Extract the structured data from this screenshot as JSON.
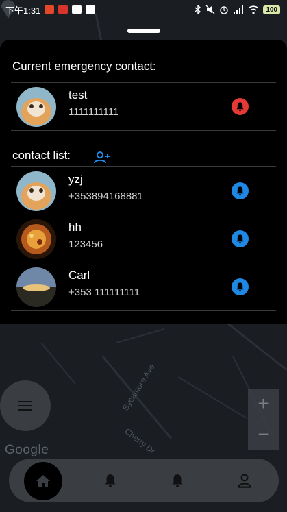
{
  "status_bar": {
    "time": "下午1:31",
    "battery": "100"
  },
  "emergency": {
    "title": "Current emergency contact:",
    "contact": {
      "name": "test",
      "phone": "1111111111",
      "bell_color": "#e53935"
    }
  },
  "contacts": {
    "title": "contact list:",
    "items": [
      {
        "name": "yzj",
        "phone": "+353894168881"
      },
      {
        "name": "hh",
        "phone": "123456"
      },
      {
        "name": "Carl",
        "phone": "+353 111111111"
      }
    ],
    "bell_color": "#1e88e5"
  },
  "map": {
    "attribution": "Google",
    "streets": [
      "Sycamore Ave",
      "Cherry Dr"
    ],
    "zoom_in": "+",
    "zoom_out": "−"
  },
  "nav": {
    "items": [
      "home-icon",
      "bell-icon",
      "bell-icon",
      "person-icon"
    ]
  },
  "colors": {
    "accent_blue": "#1e88e5",
    "alert_red": "#e53935",
    "nav_bg": "#3a3d42"
  }
}
